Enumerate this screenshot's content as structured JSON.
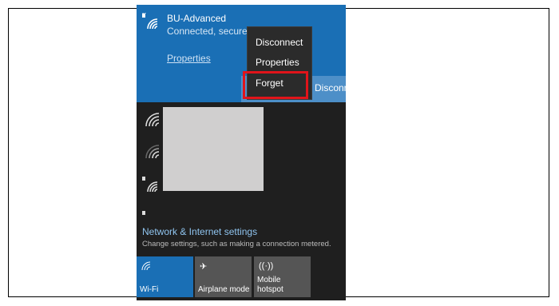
{
  "selected_network": {
    "name": "BU-Advanced",
    "status": "Connected, secure",
    "properties_link": "Properties",
    "connect_button": "Disconnect"
  },
  "context_menu": {
    "items": [
      "Disconnect",
      "Properties",
      "Forget"
    ]
  },
  "other_networks": [
    {
      "icon": "wifi-icon"
    },
    {
      "icon": "wifi-weak-icon"
    },
    {
      "icon": "wifi-secured-icon"
    }
  ],
  "network_settings": {
    "title": "Network & Internet settings",
    "subtitle": "Change settings, such as making a connection metered."
  },
  "quick_actions": [
    {
      "label": "Wi-Fi",
      "active": true,
      "icon": "wifi-icon"
    },
    {
      "label": "Airplane mode",
      "active": false,
      "icon": "airplane-icon"
    },
    {
      "label": "Mobile\nhotspot",
      "active": false,
      "icon": "hotspot-icon"
    }
  ],
  "colors": {
    "accent": "#1a6fb5",
    "highlight": "#e0141a",
    "panel": "#1f1f1f"
  }
}
